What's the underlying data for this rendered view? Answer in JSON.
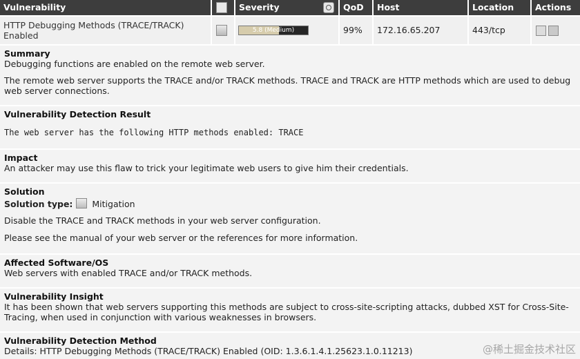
{
  "header": {
    "vulnerability": "Vulnerability",
    "severity": "Severity",
    "qod": "QoD",
    "host": "Host",
    "location": "Location",
    "actions": "Actions",
    "solution_icon": "solution-type-icon",
    "severity_icon": "sort-severity-icon"
  },
  "result": {
    "name": "HTTP Debugging Methods (TRACE/TRACK) Enabled",
    "solution_icon": "mitigation-icon",
    "severity_value": 5.8,
    "severity_max": 10,
    "severity_label": "5.8 (Medium)",
    "severity_color": "#d6ccac",
    "qod": "99%",
    "host": "172.16.65.207",
    "location": "443/tcp",
    "actions": [
      "note-icon",
      "override-icon"
    ]
  },
  "sections": {
    "summary": {
      "title": "Summary",
      "line1": "Debugging functions are enabled on the remote web server.",
      "line2": "The remote web server supports the TRACE and/or TRACK methods. TRACE and TRACK are HTTP methods which are used to debug web server connections."
    },
    "detection_result": {
      "title": "Vulnerability Detection Result",
      "text": "The web server has the following HTTP methods enabled: TRACE"
    },
    "impact": {
      "title": "Impact",
      "text": "An attacker may use this flaw to trick your legitimate web users to give him their credentials."
    },
    "solution": {
      "title": "Solution",
      "type_label": "Solution type:",
      "type_value": "Mitigation",
      "line1": "Disable the TRACE and TRACK methods in your web server configuration.",
      "line2": "Please see the manual of your web server or the references for more information."
    },
    "affected": {
      "title": "Affected Software/OS",
      "text": "Web servers with enabled TRACE and/or TRACK methods."
    },
    "insight": {
      "title": "Vulnerability Insight",
      "text": "It has been shown that web servers supporting this methods are subject to cross-site-scripting attacks, dubbed XST for Cross-Site-Tracing, when used in conjunction with various weaknesses in browsers."
    },
    "detection_method": {
      "title": "Vulnerability Detection Method",
      "text": "Details: HTTP Debugging Methods (TRACE/TRACK) Enabled (OID: 1.3.6.1.4.1.25623.1.0.11213)"
    }
  },
  "watermark": "@稀土掘金技术社区"
}
